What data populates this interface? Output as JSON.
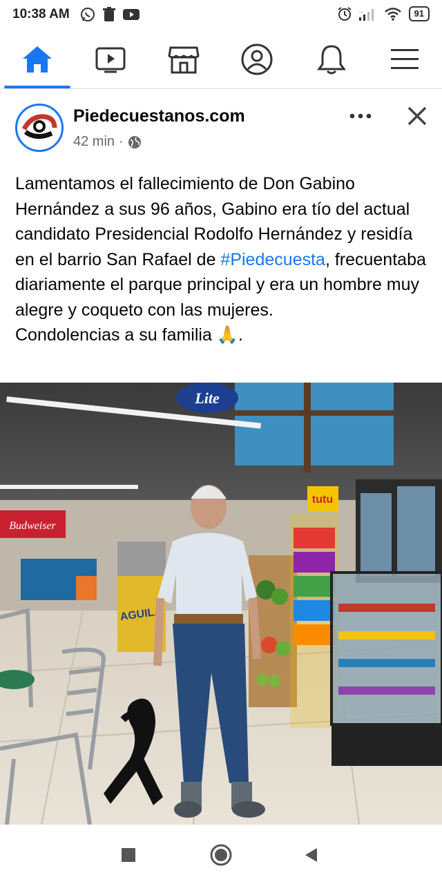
{
  "status_bar": {
    "time": "10:38 AM",
    "battery": "91"
  },
  "nav": {
    "items": [
      "home-icon",
      "video-icon",
      "marketplace-icon",
      "profile-icon",
      "bell-icon",
      "menu-icon"
    ]
  },
  "post": {
    "page_name": "Piedecuestanos.com",
    "time": "42 min",
    "separator": "·",
    "more": "•••",
    "text_part1": "Lamentamos el fallecimiento de Don Gabino Hernández a sus 96 años, Gabino era tío del actual candidato Presidencial Rodolfo Hernández y residía en el barrio San Rafael de ",
    "hashtag": "#Piedecuesta",
    "text_part2": ", frecuentaba diariamente el parque principal y era un hombre muy alegre y coqueto con las mujeres.",
    "text_line2": "Condolencias a su familia 🙏.",
    "photo_signs": {
      "beer": "Lite",
      "budweiser": "Budweiser",
      "aguila": "AGUILA",
      "snack": "tutu"
    }
  },
  "colors": {
    "accent": "#1877f2",
    "text": "#050505",
    "muted": "#65676b"
  }
}
